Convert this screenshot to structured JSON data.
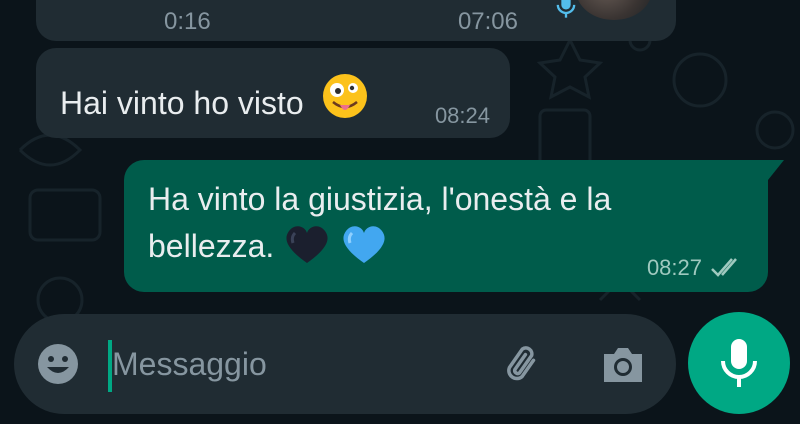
{
  "chat": {
    "voice_message": {
      "duration": "0:16",
      "time": "07:06"
    },
    "messages": [
      {
        "direction": "incoming",
        "text": "Hai vinto ho visto",
        "emoji": "zany-face",
        "time": "08:24"
      },
      {
        "direction": "outgoing",
        "text": "Ha vinto la giustizia, l'onestà e la bellezza.",
        "emojis": [
          "black-heart",
          "blue-heart"
        ],
        "time": "08:27",
        "status": "read-double-check"
      }
    ]
  },
  "input": {
    "placeholder": "Messaggio",
    "value": ""
  },
  "icons": {
    "emoji": "smiley-icon",
    "attach": "paperclip-icon",
    "camera": "camera-icon",
    "mic": "microphone-icon"
  },
  "colors": {
    "background": "#0b141a",
    "incoming_bubble": "#202c33",
    "outgoing_bubble": "#005c4b",
    "accent": "#00a884",
    "secondary_text": "#8696a0"
  }
}
